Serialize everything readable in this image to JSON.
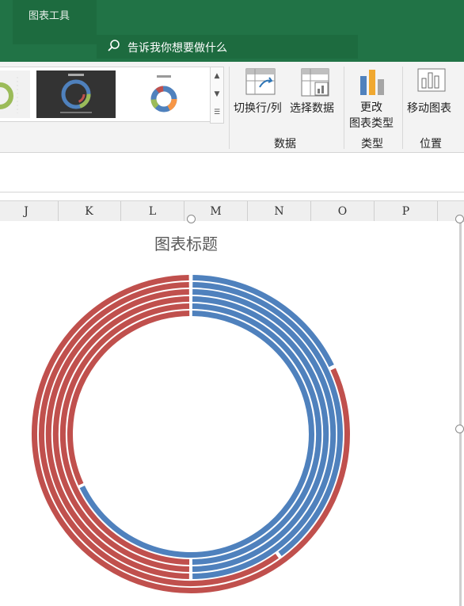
{
  "ribbon": {
    "tools_tab": "图表工具",
    "tell_me": "告诉我你想要做什么",
    "buttons": {
      "switch_row_col": "切换行/列",
      "select_data": "选择数据",
      "change_type_line1": "更改",
      "change_type_line2": "图表类型",
      "move_chart": "移动图表"
    },
    "groups": {
      "data": "数据",
      "type": "类型",
      "location": "位置"
    }
  },
  "columns": [
    "J",
    "K",
    "L",
    "M",
    "N",
    "O",
    "P"
  ],
  "chart": {
    "title": "图表标题",
    "colors": {
      "series_a": "#4f81bd",
      "series_b": "#c0504d"
    }
  },
  "chart_data": {
    "type": "doughnut",
    "title": "图表标题",
    "rings": [
      {
        "values": [
          0.18,
          0.82
        ],
        "colors": [
          "#4f81bd",
          "#c0504d"
        ]
      },
      {
        "values": [
          0.4,
          0.6
        ],
        "colors": [
          "#4f81bd",
          "#c0504d"
        ]
      },
      {
        "values": [
          0.5,
          0.5
        ],
        "colors": [
          "#4f81bd",
          "#c0504d"
        ]
      },
      {
        "values": [
          0.5,
          0.5
        ],
        "colors": [
          "#4f81bd",
          "#c0504d"
        ]
      },
      {
        "values": [
          0.5,
          0.5
        ],
        "colors": [
          "#4f81bd",
          "#c0504d"
        ]
      },
      {
        "values": [
          0.68,
          0.32
        ],
        "colors": [
          "#4f81bd",
          "#c0504d"
        ]
      }
    ]
  }
}
